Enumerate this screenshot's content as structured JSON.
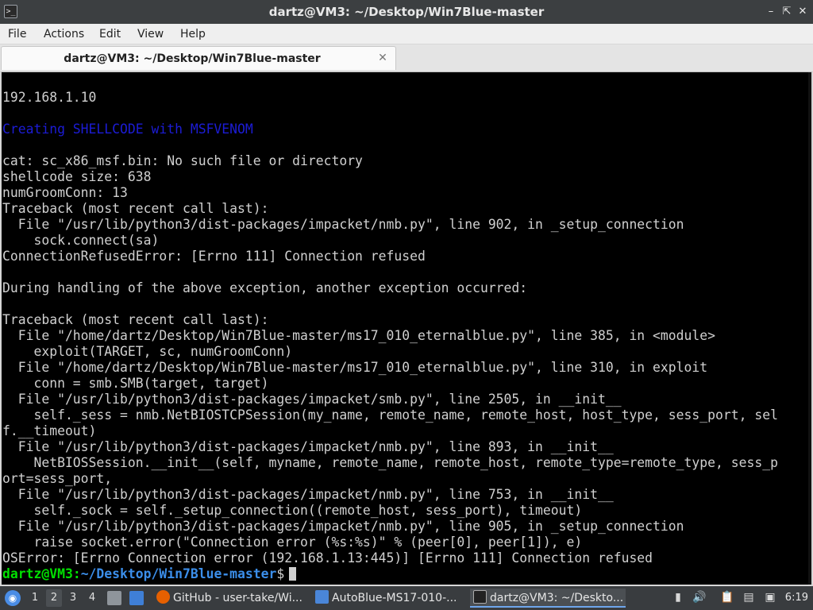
{
  "window": {
    "title": "dartz@VM3: ~/Desktop/Win7Blue-master",
    "app_icon": "terminal-icon",
    "controls": [
      "minimize",
      "maximize",
      "close"
    ]
  },
  "menu": [
    "File",
    "Actions",
    "Edit",
    "View",
    "Help"
  ],
  "tab": {
    "label": "dartz@VM3: ~/Desktop/Win7Blue-master",
    "close_icon": "close-icon"
  },
  "terminal": {
    "lines": [
      {
        "text": "192.168.1.10",
        "style": "normal"
      },
      {
        "text": "",
        "style": "normal"
      },
      {
        "text": "Creating SHELLCODE with MSFVENOM",
        "style": "blue"
      },
      {
        "text": "",
        "style": "normal"
      },
      {
        "text": "cat: sc_x86_msf.bin: No such file or directory",
        "style": "normal"
      },
      {
        "text": "shellcode size: 638",
        "style": "normal"
      },
      {
        "text": "numGroomConn: 13",
        "style": "normal"
      },
      {
        "text": "Traceback (most recent call last):",
        "style": "normal"
      },
      {
        "text": "  File \"/usr/lib/python3/dist-packages/impacket/nmb.py\", line 902, in _setup_connection",
        "style": "normal"
      },
      {
        "text": "    sock.connect(sa)",
        "style": "normal"
      },
      {
        "text": "ConnectionRefusedError: [Errno 111] Connection refused",
        "style": "normal"
      },
      {
        "text": "",
        "style": "normal"
      },
      {
        "text": "During handling of the above exception, another exception occurred:",
        "style": "normal"
      },
      {
        "text": "",
        "style": "normal"
      },
      {
        "text": "Traceback (most recent call last):",
        "style": "normal"
      },
      {
        "text": "  File \"/home/dartz/Desktop/Win7Blue-master/ms17_010_eternalblue.py\", line 385, in <module>",
        "style": "normal"
      },
      {
        "text": "    exploit(TARGET, sc, numGroomConn)",
        "style": "normal"
      },
      {
        "text": "  File \"/home/dartz/Desktop/Win7Blue-master/ms17_010_eternalblue.py\", line 310, in exploit",
        "style": "normal"
      },
      {
        "text": "    conn = smb.SMB(target, target)",
        "style": "normal"
      },
      {
        "text": "  File \"/usr/lib/python3/dist-packages/impacket/smb.py\", line 2505, in __init__",
        "style": "normal"
      },
      {
        "text": "    self._sess = nmb.NetBIOSTCPSession(my_name, remote_name, remote_host, host_type, sess_port, sel",
        "style": "normal"
      },
      {
        "text": "f.__timeout)",
        "style": "normal"
      },
      {
        "text": "  File \"/usr/lib/python3/dist-packages/impacket/nmb.py\", line 893, in __init__",
        "style": "normal"
      },
      {
        "text": "    NetBIOSSession.__init__(self, myname, remote_name, remote_host, remote_type=remote_type, sess_p",
        "style": "normal"
      },
      {
        "text": "ort=sess_port,",
        "style": "normal"
      },
      {
        "text": "  File \"/usr/lib/python3/dist-packages/impacket/nmb.py\", line 753, in __init__",
        "style": "normal"
      },
      {
        "text": "    self._sock = self._setup_connection((remote_host, sess_port), timeout)",
        "style": "normal"
      },
      {
        "text": "  File \"/usr/lib/python3/dist-packages/impacket/nmb.py\", line 905, in _setup_connection",
        "style": "normal"
      },
      {
        "text": "    raise socket.error(\"Connection error (%s:%s)\" % (peer[0], peer[1]), e)",
        "style": "normal"
      },
      {
        "text": "OSError: [Errno Connection error (192.168.1.13:445)] [Errno 111] Connection refused",
        "style": "normal"
      }
    ],
    "prompt": {
      "user_host": "dartz@VM3",
      "separator": ":",
      "path": "~/Desktop/Win7Blue-master",
      "symbol": "$"
    },
    "colors": {
      "background": "#000000",
      "text": "#d0d0d0",
      "blue": "#1c1cd6",
      "prompt_user": "#00e000",
      "prompt_path": "#3b8eea"
    }
  },
  "taskbar": {
    "start_icon": "app-menu-icon",
    "workspaces": [
      "1",
      "2",
      "3",
      "4"
    ],
    "active_workspace": "2",
    "tasks": [
      {
        "icon": "firefox-icon",
        "label": "GitHub - user-take/Wi..."
      },
      {
        "icon": "folder-icon",
        "label": "AutoBlue-MS17-010-..."
      },
      {
        "icon": "terminal-icon",
        "label": "dartz@VM3: ~/Deskto..."
      }
    ],
    "tray_icons": [
      "battery-icon",
      "volume-icon",
      "clipboard-icon",
      "network-icon",
      "screenshot-icon"
    ],
    "clock": "6:19"
  }
}
